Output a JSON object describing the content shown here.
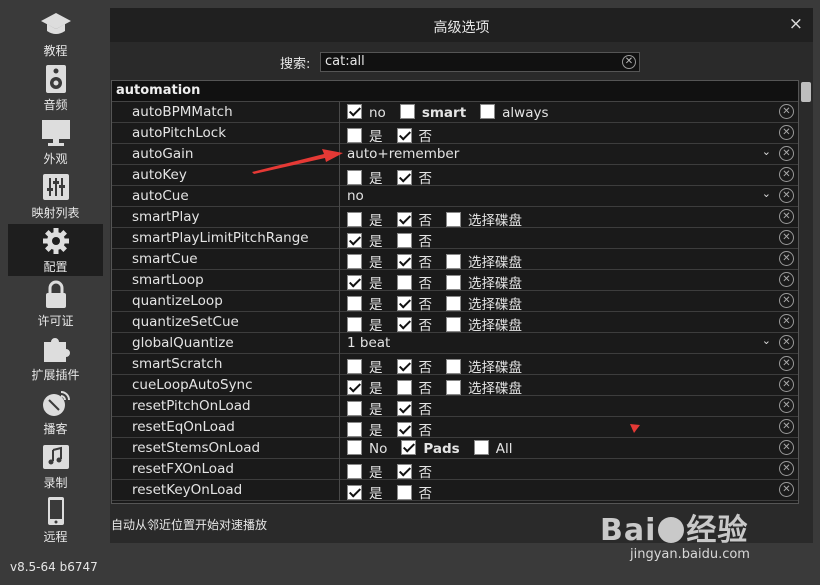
{
  "sidebar": {
    "items": [
      {
        "label": "教程",
        "icon": "graduation-cap-icon",
        "active": false
      },
      {
        "label": "音频",
        "icon": "speaker-icon",
        "active": false
      },
      {
        "label": "外观",
        "icon": "monitor-icon",
        "active": false
      },
      {
        "label": "映射列表",
        "icon": "sliders-icon",
        "active": false
      },
      {
        "label": "配置",
        "icon": "gear-icon",
        "active": true
      },
      {
        "label": "许可证",
        "icon": "lock-icon",
        "active": false
      },
      {
        "label": "扩展插件",
        "icon": "puzzle-icon",
        "active": false
      },
      {
        "label": "播客",
        "icon": "satellite-dish-icon",
        "active": false
      },
      {
        "label": "录制",
        "icon": "music-note-icon",
        "active": false
      },
      {
        "label": "远程",
        "icon": "phone-icon",
        "active": false
      }
    ],
    "version": "v8.5-64 b6747"
  },
  "panel": {
    "title": "高级选项",
    "close_glyph": "×",
    "search_label": "搜索:",
    "search_value": "cat:all",
    "group": "automation",
    "description": "自动从邻近位置开始对速播放"
  },
  "rows": [
    {
      "name": "autoBPMMatch",
      "type": "options",
      "options": [
        {
          "label": "no",
          "checked": true
        },
        {
          "label": "smart",
          "checked": false,
          "bold": true
        },
        {
          "label": "always",
          "checked": false
        }
      ]
    },
    {
      "name": "autoPitchLock",
      "type": "options",
      "options": [
        {
          "label": "是",
          "checked": false
        },
        {
          "label": "否",
          "checked": true
        }
      ]
    },
    {
      "name": "autoGain",
      "type": "dropdown",
      "value": "auto+remember"
    },
    {
      "name": "autoKey",
      "type": "options",
      "options": [
        {
          "label": "是",
          "checked": false
        },
        {
          "label": "否",
          "checked": true
        }
      ]
    },
    {
      "name": "autoCue",
      "type": "dropdown",
      "value": "no"
    },
    {
      "name": "smartPlay",
      "type": "options",
      "options": [
        {
          "label": "是",
          "checked": false
        },
        {
          "label": "否",
          "checked": true
        },
        {
          "label": "选择碟盘",
          "checked": false
        }
      ]
    },
    {
      "name": "smartPlayLimitPitchRange",
      "type": "options",
      "options": [
        {
          "label": "是",
          "checked": true
        },
        {
          "label": "否",
          "checked": false
        }
      ]
    },
    {
      "name": "smartCue",
      "type": "options",
      "options": [
        {
          "label": "是",
          "checked": false
        },
        {
          "label": "否",
          "checked": true
        },
        {
          "label": "选择碟盘",
          "checked": false
        }
      ]
    },
    {
      "name": "smartLoop",
      "type": "options",
      "options": [
        {
          "label": "是",
          "checked": true
        },
        {
          "label": "否",
          "checked": false
        },
        {
          "label": "选择碟盘",
          "checked": false
        }
      ]
    },
    {
      "name": "quantizeLoop",
      "type": "options",
      "options": [
        {
          "label": "是",
          "checked": false
        },
        {
          "label": "否",
          "checked": true
        },
        {
          "label": "选择碟盘",
          "checked": false
        }
      ]
    },
    {
      "name": "quantizeSetCue",
      "type": "options",
      "options": [
        {
          "label": "是",
          "checked": false
        },
        {
          "label": "否",
          "checked": true
        },
        {
          "label": "选择碟盘",
          "checked": false
        }
      ]
    },
    {
      "name": "globalQuantize",
      "type": "dropdown",
      "value": "1 beat"
    },
    {
      "name": "smartScratch",
      "type": "options",
      "options": [
        {
          "label": "是",
          "checked": false
        },
        {
          "label": "否",
          "checked": true
        },
        {
          "label": "选择碟盘",
          "checked": false
        }
      ]
    },
    {
      "name": "cueLoopAutoSync",
      "type": "options",
      "options": [
        {
          "label": "是",
          "checked": true
        },
        {
          "label": "否",
          "checked": false
        },
        {
          "label": "选择碟盘",
          "checked": false
        }
      ]
    },
    {
      "name": "resetPitchOnLoad",
      "type": "options",
      "options": [
        {
          "label": "是",
          "checked": false
        },
        {
          "label": "否",
          "checked": true
        }
      ]
    },
    {
      "name": "resetEqOnLoad",
      "type": "options",
      "options": [
        {
          "label": "是",
          "checked": false
        },
        {
          "label": "否",
          "checked": true
        }
      ]
    },
    {
      "name": "resetStemsOnLoad",
      "type": "options",
      "options": [
        {
          "label": "No",
          "checked": false
        },
        {
          "label": "Pads",
          "checked": true,
          "bold": true
        },
        {
          "label": "All",
          "checked": false
        }
      ]
    },
    {
      "name": "resetFXOnLoad",
      "type": "options",
      "options": [
        {
          "label": "是",
          "checked": false
        },
        {
          "label": "否",
          "checked": true
        }
      ]
    },
    {
      "name": "resetKeyOnLoad",
      "type": "options",
      "options": [
        {
          "label": "是",
          "checked": true
        },
        {
          "label": "否",
          "checked": false
        }
      ]
    }
  ],
  "watermark": {
    "brand": "Bai",
    "brand_cn": "经验",
    "url": "jingyan.baidu.com"
  },
  "colors": {
    "annotation_arrow": "#e53935",
    "background": "#3a3a3a",
    "panel": "#2a2a2a"
  }
}
